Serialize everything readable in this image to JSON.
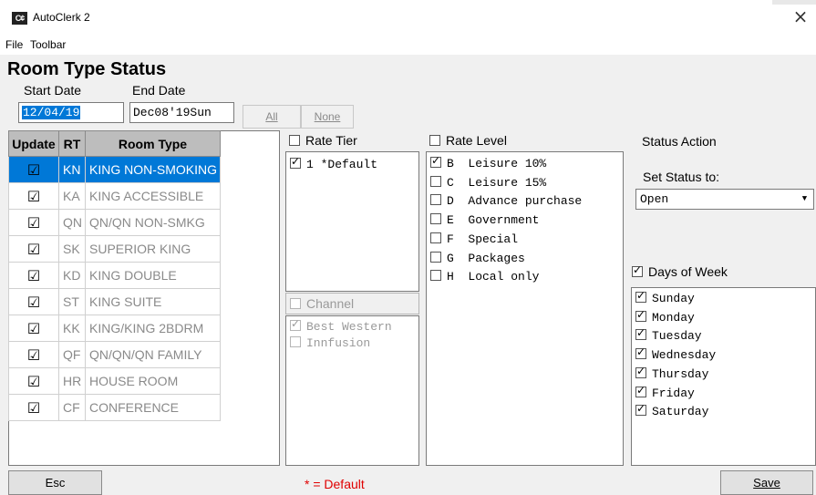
{
  "window": {
    "app_icon_text": "C¢",
    "title": "AutoClerk 2",
    "close_glyph": "×"
  },
  "menu": {
    "items": [
      "File",
      "Toolbar"
    ]
  },
  "page_title": "Room Type Status",
  "dates": {
    "start_label": "Start Date",
    "start_value": "12/04/19",
    "end_label": "End Date",
    "end_value": "Dec08'19Sun"
  },
  "buttons": {
    "all": "All",
    "none": "None",
    "esc": "Esc",
    "save": "Save"
  },
  "room_table": {
    "headers": [
      "Update",
      "RT",
      "Room Type"
    ],
    "rows": [
      {
        "checked": true,
        "code": "KN",
        "name": "KING NON-SMOKING",
        "selected": true
      },
      {
        "checked": true,
        "code": "KA",
        "name": "KING ACCESSIBLE"
      },
      {
        "checked": true,
        "code": "QN",
        "name": "QN/QN NON-SMKG"
      },
      {
        "checked": true,
        "code": "SK",
        "name": "SUPERIOR KING"
      },
      {
        "checked": true,
        "code": "KD",
        "name": "KING DOUBLE"
      },
      {
        "checked": true,
        "code": "ST",
        "name": "KING SUITE"
      },
      {
        "checked": true,
        "code": "KK",
        "name": "KING/KING 2BDRM"
      },
      {
        "checked": true,
        "code": "QF",
        "name": "QN/QN/QN FAMILY"
      },
      {
        "checked": true,
        "code": "HR",
        "name": "HOUSE ROOM"
      },
      {
        "checked": true,
        "code": "CF",
        "name": "CONFERENCE"
      }
    ]
  },
  "rate_tier": {
    "label": "Rate Tier",
    "checked": false,
    "items": [
      {
        "checked": true,
        "text": "1 *Default"
      }
    ]
  },
  "channel": {
    "label": "Channel",
    "checked": false,
    "items": [
      {
        "checked": true,
        "text": "Best Western"
      },
      {
        "checked": false,
        "text": "Innfusion"
      }
    ]
  },
  "rate_level": {
    "label": "Rate Level",
    "checked": false,
    "items": [
      {
        "checked": true,
        "text": "B  Leisure 10%"
      },
      {
        "checked": false,
        "text": "C  Leisure 15%"
      },
      {
        "checked": false,
        "text": "D  Advance purchase"
      },
      {
        "checked": false,
        "text": "E  Government"
      },
      {
        "checked": false,
        "text": "F  Special"
      },
      {
        "checked": false,
        "text": "G  Packages"
      },
      {
        "checked": false,
        "text": "H  Local only"
      }
    ]
  },
  "status_action": {
    "label": "Status Action",
    "set_label": "Set Status to:",
    "value": "Open"
  },
  "days_of_week": {
    "label": "Days of Week",
    "checked": true,
    "items": [
      {
        "checked": true,
        "text": "Sunday"
      },
      {
        "checked": true,
        "text": "Monday"
      },
      {
        "checked": true,
        "text": "Tuesday"
      },
      {
        "checked": true,
        "text": "Wednesday"
      },
      {
        "checked": true,
        "text": "Thursday"
      },
      {
        "checked": true,
        "text": "Friday"
      },
      {
        "checked": true,
        "text": "Saturday"
      }
    ]
  },
  "footer_note": "* = Default",
  "colors": {
    "selection": "#0078d7",
    "header_gray": "#bdbdbd",
    "note_red": "#e00000"
  }
}
